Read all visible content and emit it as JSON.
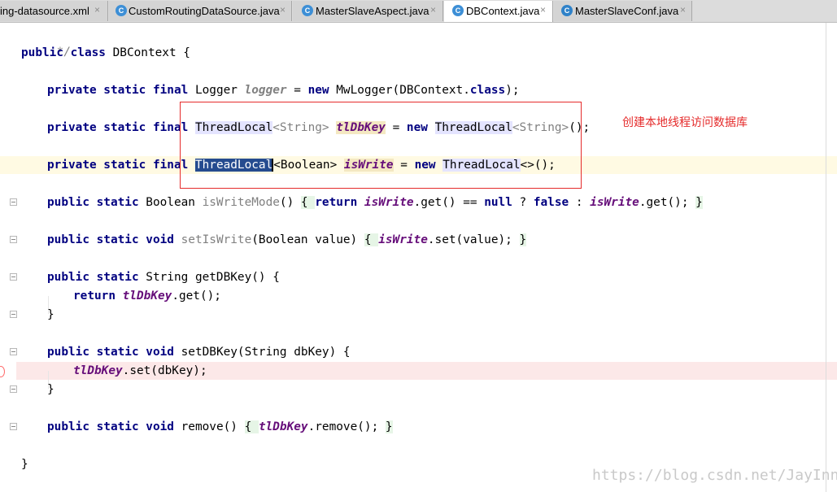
{
  "tabs": [
    {
      "label": "ing-datasource.xml",
      "icon": "xml-file-icon",
      "active": false
    },
    {
      "label": "CustomRoutingDataSource.java",
      "icon": "java-class-icon",
      "active": false
    },
    {
      "label": "MasterSlaveAspect.java",
      "icon": "java-class-icon",
      "active": false
    },
    {
      "label": "DBContext.java",
      "icon": "java-class-icon",
      "active": true
    },
    {
      "label": "MasterSlaveConf.java",
      "icon": "java-config-class-icon",
      "active": false
    }
  ],
  "tab_close_glyph": "×",
  "tab_icon_glyph": "C",
  "code": {
    "l1": {
      "t0": "*/"
    },
    "l2": {
      "t0": "public class ",
      "t1": "DBContext {"
    },
    "l3": {
      "t0": "private static final ",
      "t1": "Logger ",
      "t2": "logger",
      "t3": " = ",
      "t4": "new ",
      "t5": "MwLogger(DBContext.",
      "t6": "class",
      "t7": ");"
    },
    "l4": {
      "t0": "private static final ",
      "t1": "ThreadLocal",
      "t2": "<String> ",
      "t3": "tlDbKey",
      "t4": " = ",
      "t5": "new ",
      "t6": "ThreadLocal",
      "t7": "<String>",
      "t8": "();"
    },
    "l5": {
      "t0": "private static final ",
      "t1": "ThreadLocal",
      "t2": "<Boolean> ",
      "t3": "isWrite",
      "t4": " = ",
      "t5": "new ",
      "t6": "ThreadLocal",
      "t7": "<>",
      "t8": "();"
    },
    "l6": {
      "t0": "public static ",
      "t1": "Boolean ",
      "t2": "isWriteMode",
      "t3": "() ",
      "t4": "{ ",
      "t5": "return ",
      "t6": "isWrite",
      "t7": ".get() == ",
      "t8": "null",
      "t9": " ? ",
      "t10": "false",
      "t11": " : ",
      "t12": "isWrite",
      "t13": ".get(); ",
      "t14": "}"
    },
    "l7": {
      "t0": "public static void ",
      "t1": "setIsWrite",
      "t2": "(Boolean value) ",
      "t3": "{ ",
      "t4": "isWrite",
      "t5": ".set(value); ",
      "t6": "}"
    },
    "l8": {
      "t0": "public static ",
      "t1": "String getDBKey() {"
    },
    "l9": {
      "t0": "return ",
      "t1": "tlDbKey",
      "t2": ".get();"
    },
    "l10": {
      "t0": "}"
    },
    "l11": {
      "t0": "public static void ",
      "t1": "setDBKey(String dbKey) {"
    },
    "l12": {
      "t0": "tlDbKey",
      "t1": ".set(dbKey);"
    },
    "l13": {
      "t0": "}"
    },
    "l14": {
      "t0": "public static void ",
      "t1": "remove() ",
      "t2": "{ ",
      "t3": "tlDbKey",
      "t4": ".remove(); ",
      "t5": "}"
    },
    "l15": {
      "t0": "}"
    }
  },
  "annotation_note": "创建本地线程访问数据库",
  "watermark": "https://blog.csdn.net/JayInnn",
  "colors": {
    "keyword": "#000080",
    "static_field": "#660e7a",
    "comment": "#808080",
    "annotation": "#e52b2b",
    "selection": "#254b8f",
    "current_line": "#fffae3",
    "error_line": "#fce8e8"
  }
}
